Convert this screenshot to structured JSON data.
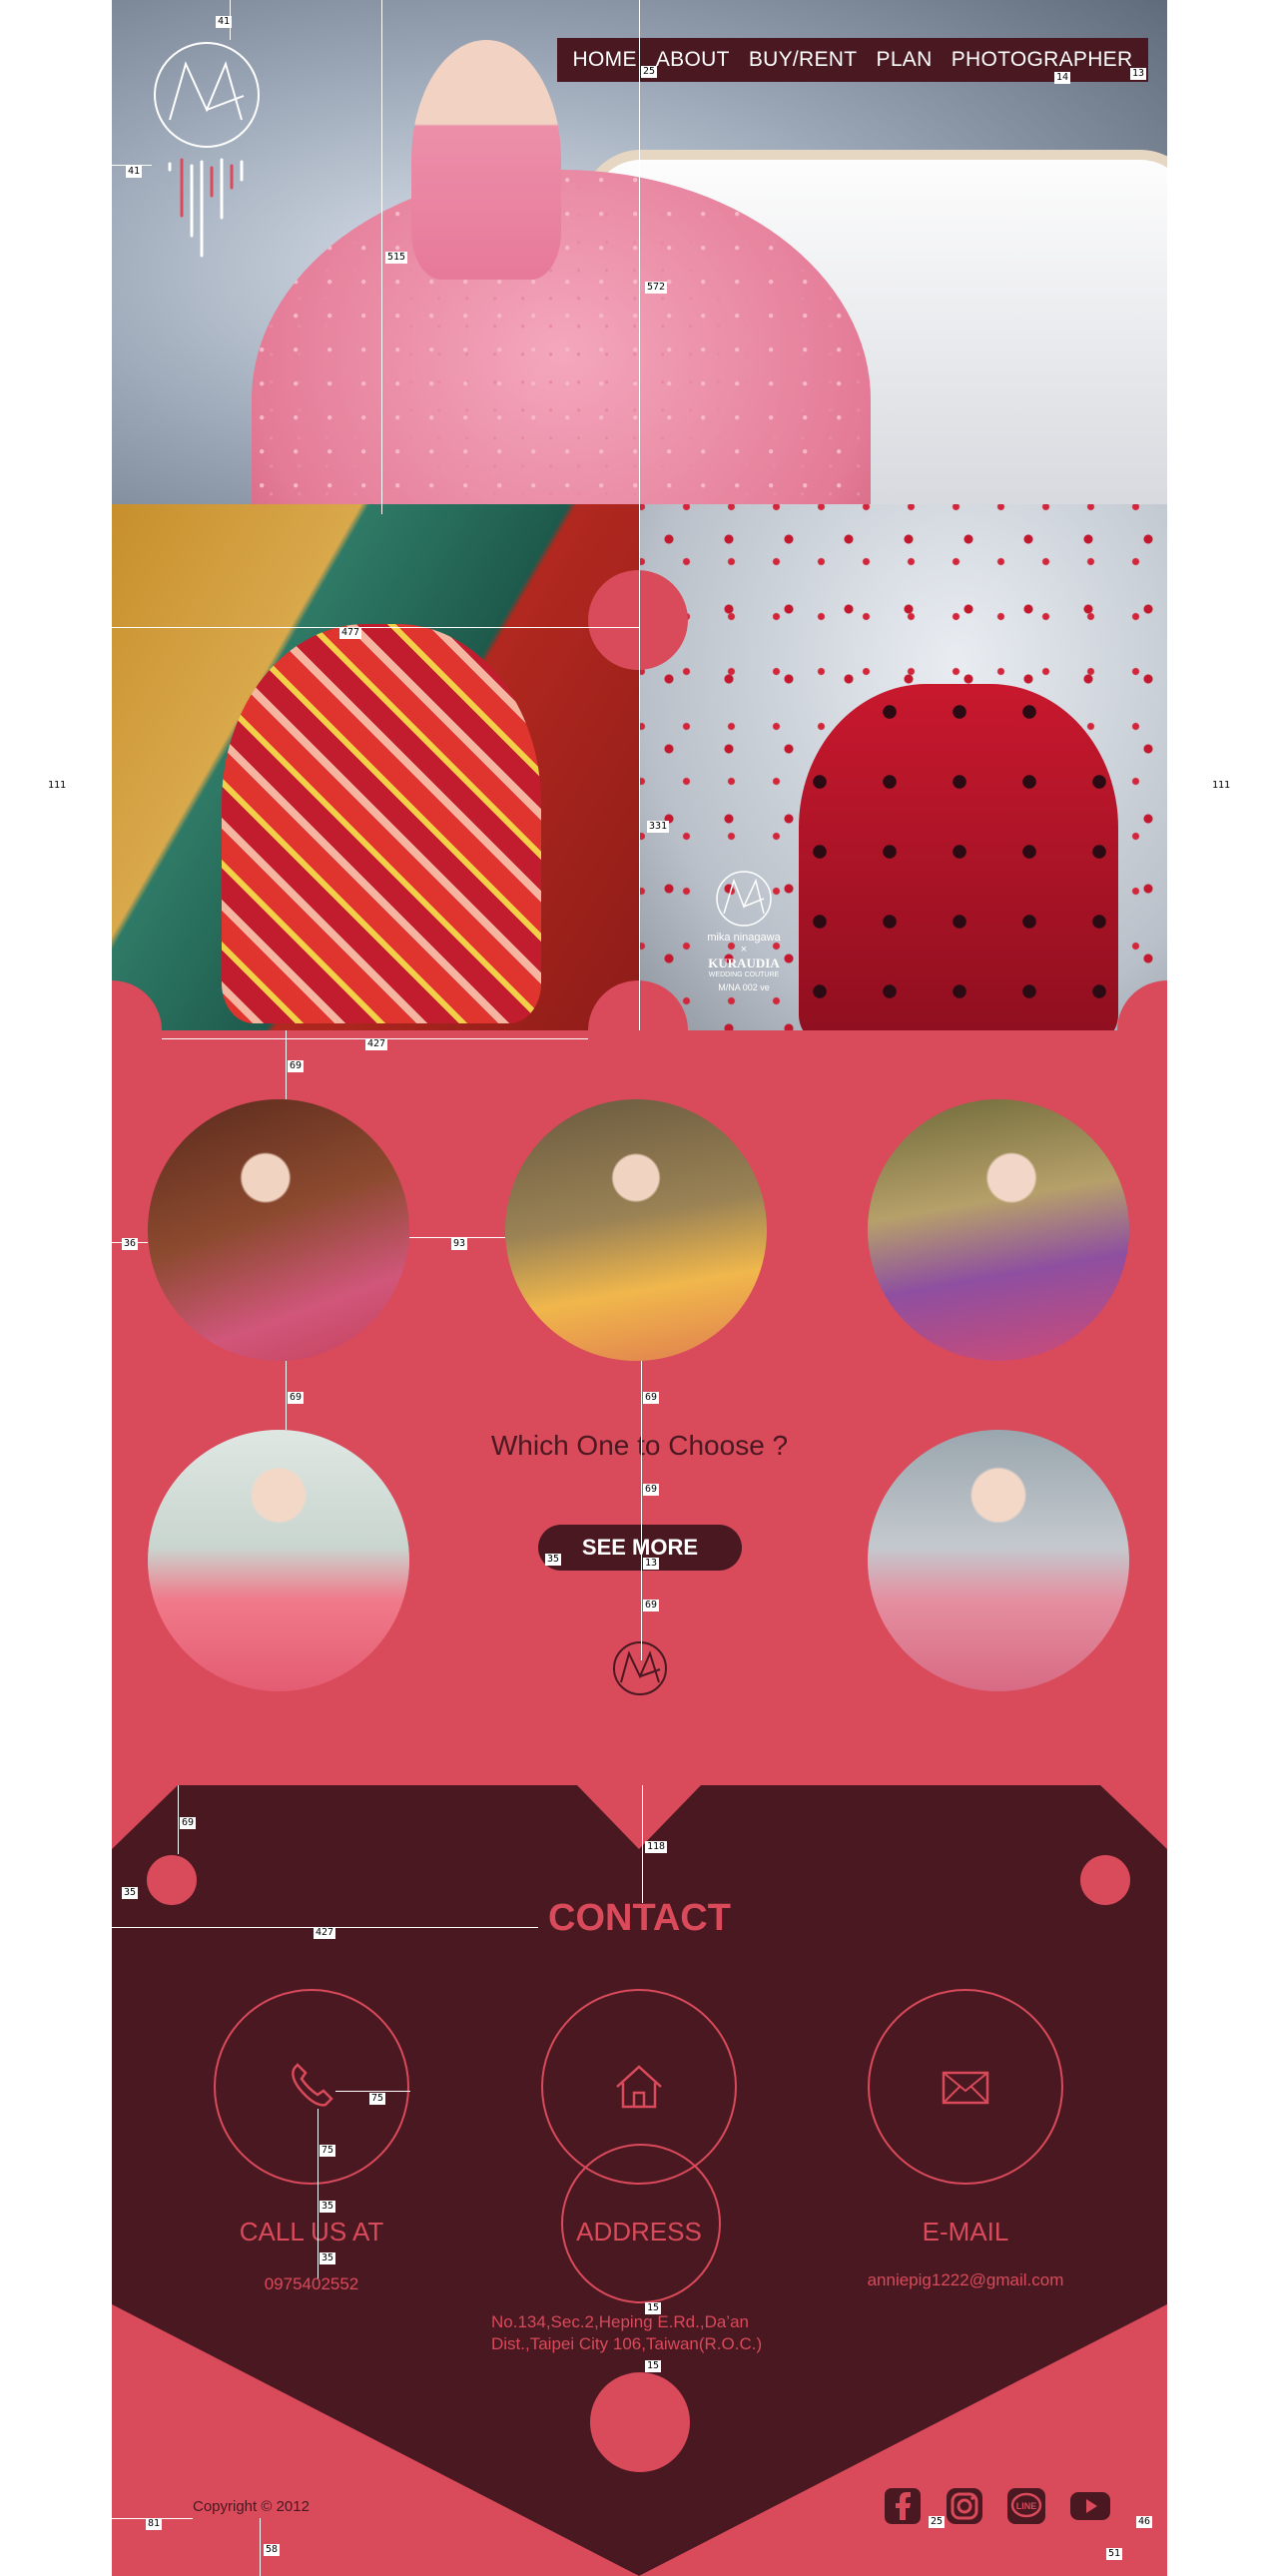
{
  "nav": {
    "items": [
      "HOME",
      "ABOUT",
      "BUY/RENT",
      "PLAN",
      "PHOTOGRAPHER"
    ]
  },
  "hero": {
    "brand_lines": [
      "mika ninagawa",
      "×",
      "KURAUDIA",
      "WEDDING COUTURE",
      "M/NA 002 ve"
    ]
  },
  "gallery": {
    "heading": "Which One to Choose ?",
    "button_label": "SEE MORE"
  },
  "contact": {
    "title": "CONTACT",
    "phone_label": "CALL US AT",
    "phone_value": "0975402552",
    "address_label": "ADDRESS",
    "address_line1": "No.134,Sec.2,Heping E.Rd.,Da’an",
    "address_line2": "Dist.,Taipei City 106,Taiwan(R.O.C.)",
    "email_label": "E-MAIL",
    "email_value": "anniepig1222@gmail.com"
  },
  "footer": {
    "copyright": "Copyright © 2012",
    "social_icons": [
      "facebook-icon",
      "instagram-icon",
      "line-icon",
      "youtube-icon"
    ]
  },
  "colors": {
    "accent": "#d94a5b",
    "dark": "#4a1820",
    "white": "#ffffff"
  },
  "annotations": [
    "41",
    "41",
    "25",
    "572",
    "14",
    "13",
    "515",
    "477",
    "111",
    "111",
    "331",
    "427",
    "69",
    "36",
    "93",
    "69",
    "69",
    "69",
    "35",
    "13",
    "69",
    "69",
    "118",
    "35",
    "427",
    "75",
    "75",
    "35",
    "35",
    "15",
    "15",
    "81",
    "58",
    "25",
    "46",
    "51"
  ]
}
